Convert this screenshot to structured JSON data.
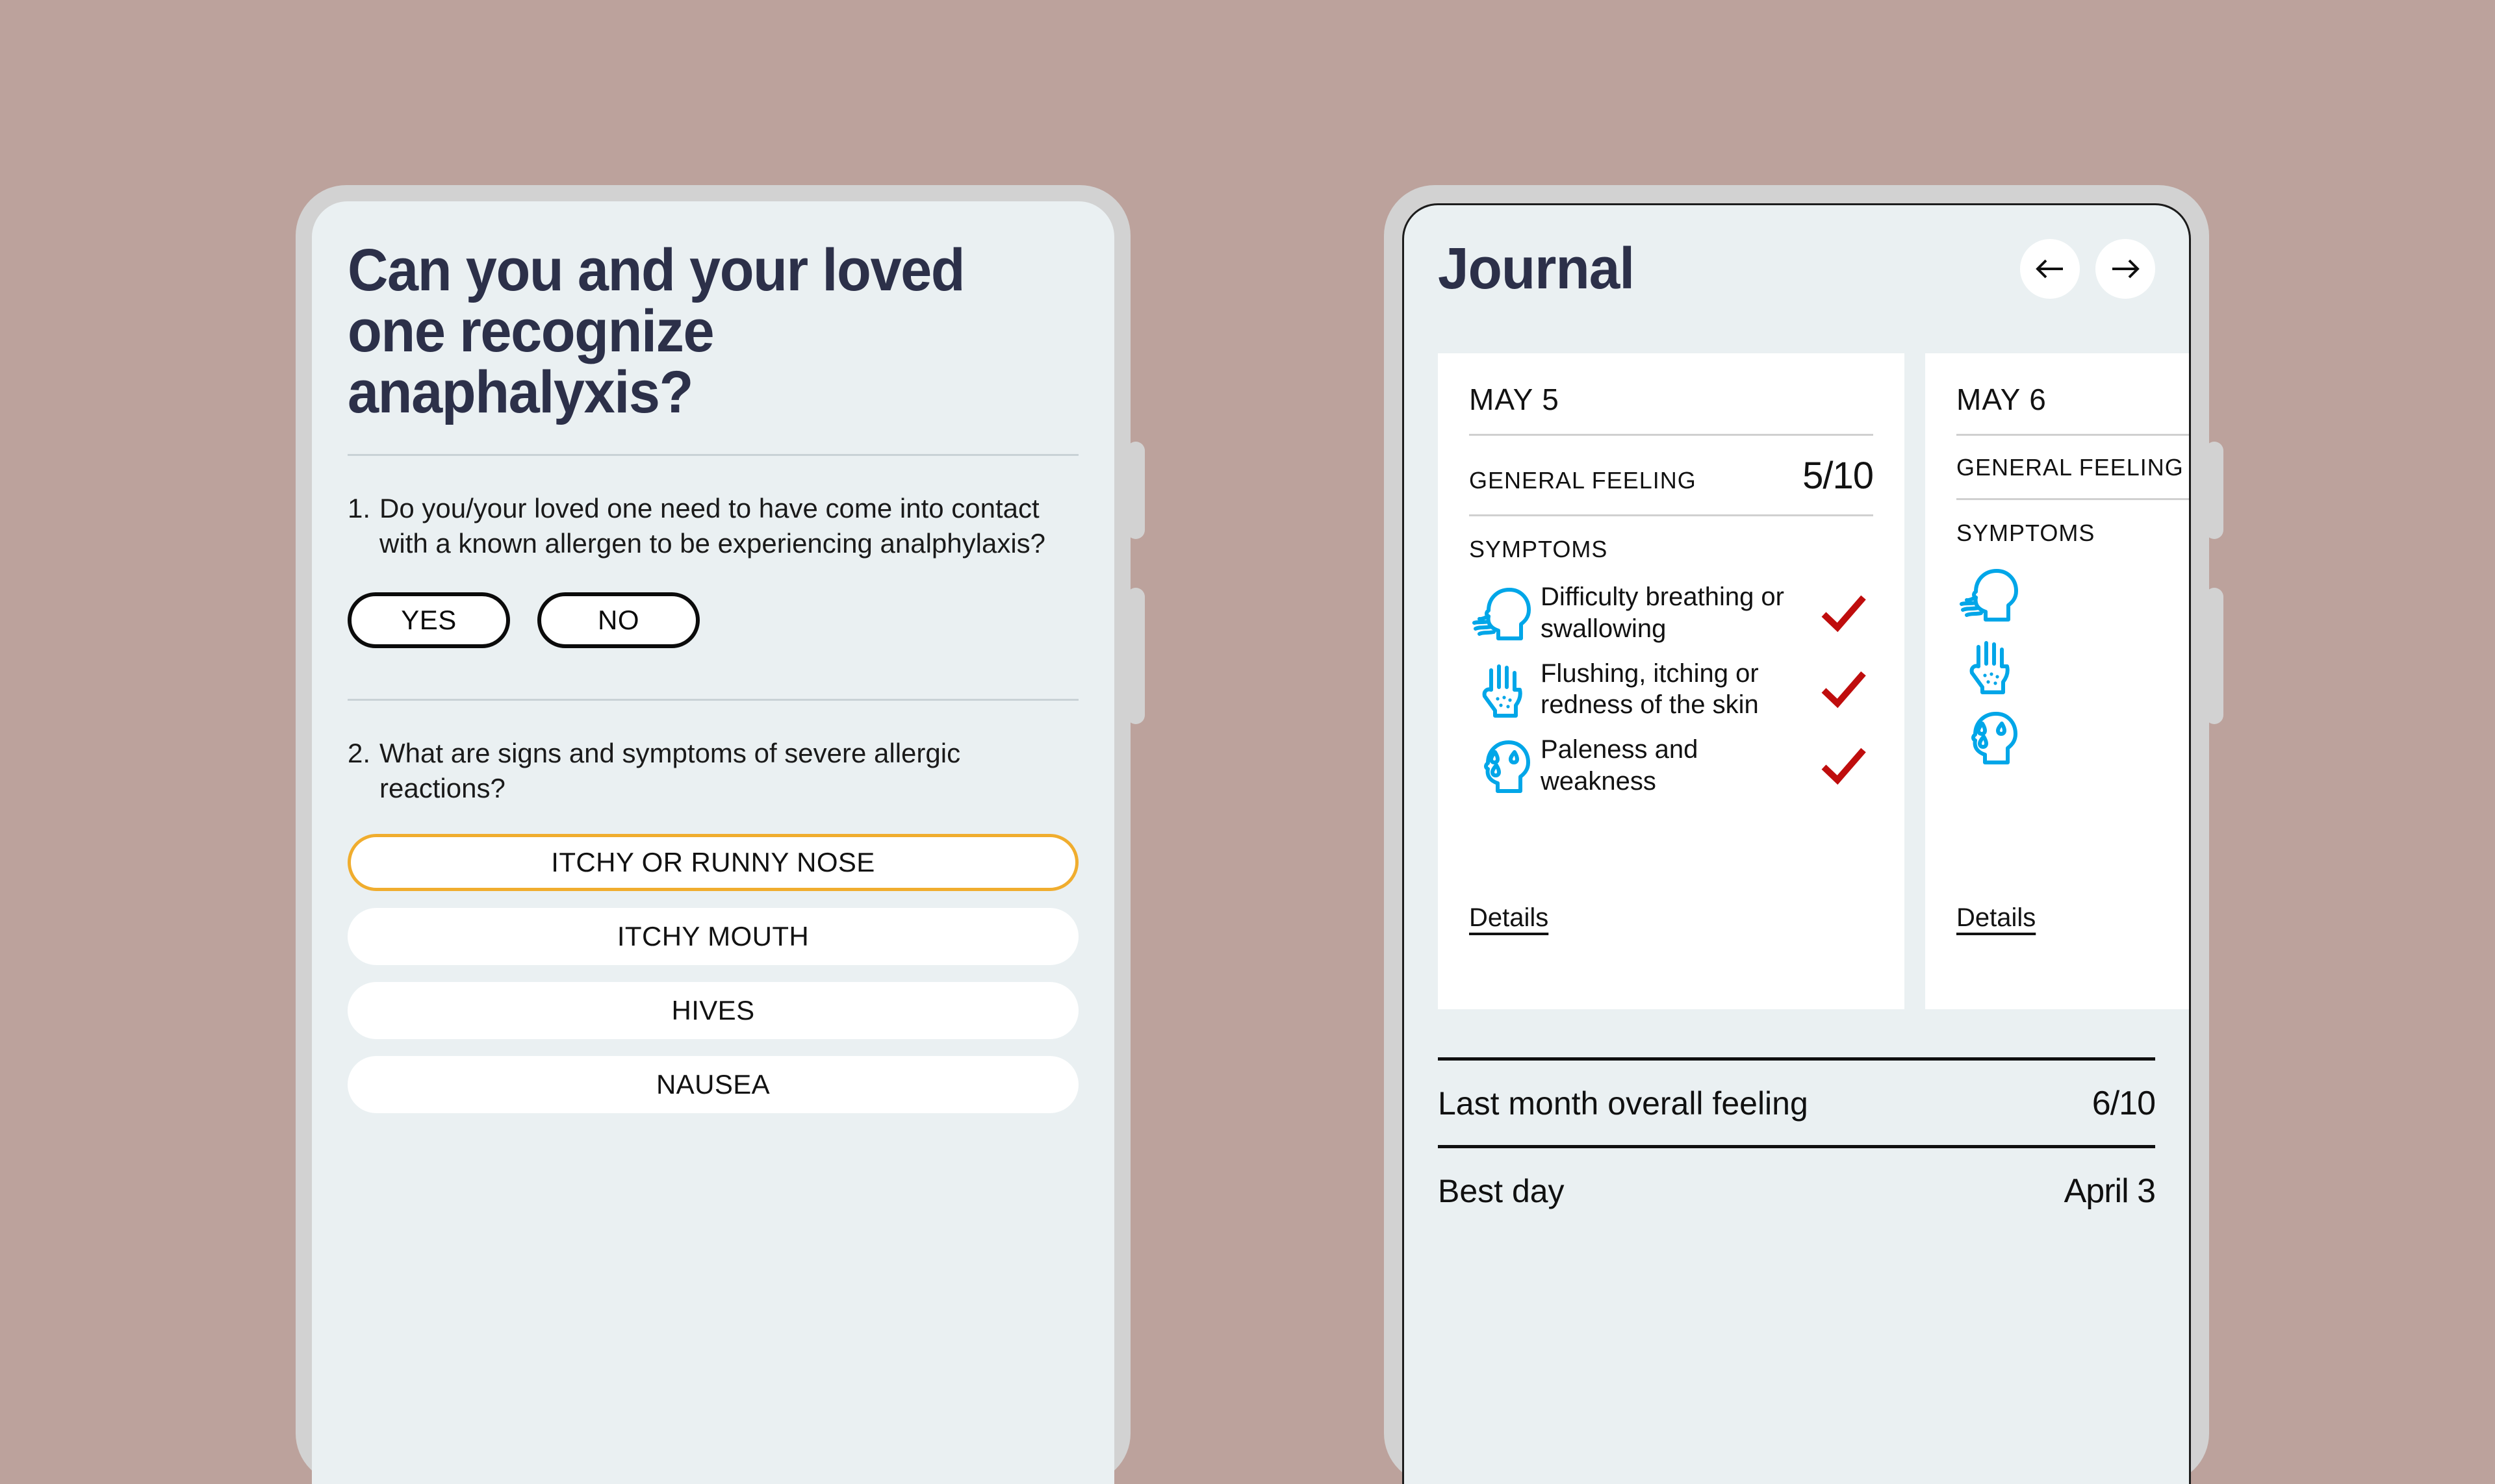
{
  "theme": {
    "background": "#bca29c",
    "phone_frame": "#d2d2d2",
    "screen_bg": "#eaf0f2",
    "heading_color": "#2c3049",
    "accent_amber": "#f0ad2e",
    "check_red": "#bf0d0d",
    "icon_cyan": "#00a6e8"
  },
  "quiz": {
    "title": "Can you and your loved one recognize anaphalyxis?",
    "questions": [
      {
        "number": "1.",
        "text": "Do you/your loved one need to have come into contact with a known allergen to be experiencing analphylaxis?",
        "answers": [
          {
            "label": "YES",
            "selected": false
          },
          {
            "label": "NO",
            "selected": false
          }
        ]
      },
      {
        "number": "2.",
        "text": "What are signs and symptoms of severe allergic reactions?",
        "options": [
          {
            "label": "ITCHY OR RUNNY NOSE",
            "selected": true
          },
          {
            "label": "ITCHY MOUTH",
            "selected": false
          },
          {
            "label": "HIVES",
            "selected": false
          },
          {
            "label": "NAUSEA",
            "selected": false
          }
        ]
      }
    ]
  },
  "journal": {
    "title": "Journal",
    "nav": {
      "prev_icon": "arrow-left-icon",
      "next_icon": "arrow-right-icon"
    },
    "cards": [
      {
        "date": "MAY 5",
        "feeling_label": "GENERAL FEELING",
        "feeling_value": "5/10",
        "symptoms_label": "SYMPTOMS",
        "symptoms": [
          {
            "icon": "breathing-head-icon",
            "text": "Difficulty breathing or swallowing",
            "checked": true
          },
          {
            "icon": "itchy-hand-icon",
            "text": "Flushing, itching or redness of the skin",
            "checked": true
          },
          {
            "icon": "sweating-head-icon",
            "text": "Paleness and weakness",
            "checked": true
          }
        ],
        "details_label": "Details"
      },
      {
        "date": "MAY 6",
        "feeling_label": "GENERAL FEELING",
        "feeling_value": "",
        "symptoms_label": "SYMPTOMS",
        "symptoms": [
          {
            "icon": "breathing-head-icon",
            "text": "",
            "checked": false
          },
          {
            "icon": "itchy-hand-icon",
            "text": "",
            "checked": false
          },
          {
            "icon": "sweating-head-icon",
            "text": "",
            "checked": false
          }
        ],
        "details_label": "Details"
      }
    ],
    "summary": [
      {
        "label": "Last month overall feeling",
        "value": "6/10"
      },
      {
        "label": "Best day",
        "value": "April 3"
      }
    ]
  }
}
